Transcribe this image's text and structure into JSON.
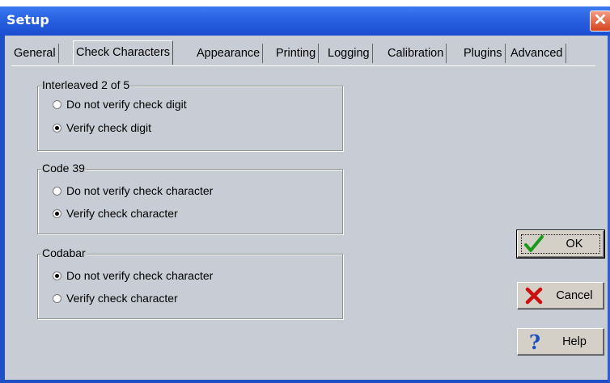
{
  "window": {
    "title": "Setup",
    "close_glyph": "✕"
  },
  "tabs": [
    {
      "label": "General",
      "active": false
    },
    {
      "label": "Check Characters",
      "active": true
    },
    {
      "label": "Appearance",
      "active": false
    },
    {
      "label": "Printing",
      "active": false
    },
    {
      "label": "Logging",
      "active": false
    },
    {
      "label": "Calibration",
      "active": false
    },
    {
      "label": "Plugins",
      "active": false
    },
    {
      "label": "Advanced",
      "active": false
    }
  ],
  "groups": [
    {
      "label": "Interleaved 2 of 5",
      "options": [
        {
          "label": "Do not verify check digit",
          "selected": false
        },
        {
          "label": "Verify check digit",
          "selected": true
        }
      ]
    },
    {
      "label": "Code 39",
      "options": [
        {
          "label": "Do not verify check character",
          "selected": false
        },
        {
          "label": "Verify check character",
          "selected": true
        }
      ]
    },
    {
      "label": "Codabar",
      "options": [
        {
          "label": "Do not verify check character",
          "selected": true
        },
        {
          "label": "Verify check character",
          "selected": false
        }
      ]
    }
  ],
  "buttons": {
    "ok": {
      "label": "OK",
      "icon": "checkmark-icon"
    },
    "cancel": {
      "label": "Cancel",
      "icon": "red-x-icon"
    },
    "help": {
      "label": "Help",
      "icon": "question-mark-icon"
    }
  },
  "colors": {
    "titlebar": "#2a63e3",
    "close": "#d5431e",
    "dialog_bg": "#c8ccd4"
  }
}
